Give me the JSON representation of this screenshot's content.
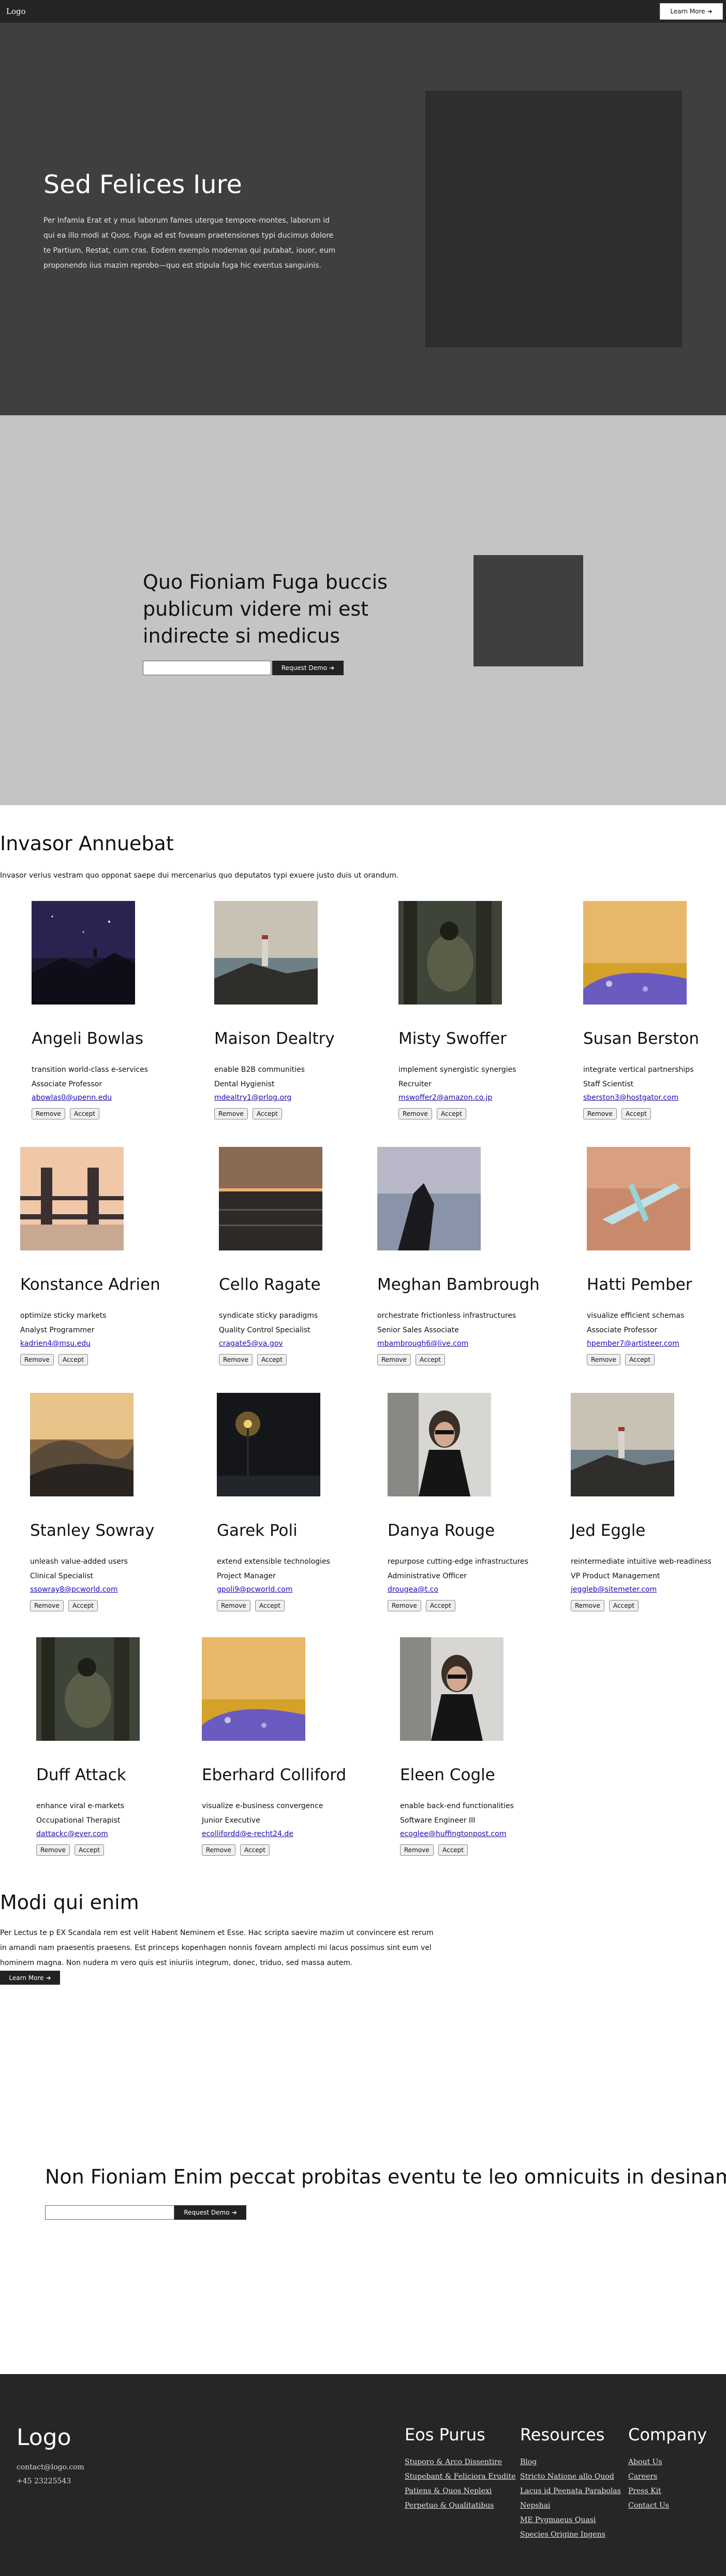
{
  "nav": {
    "logo": "Logo",
    "cta_label": "Learn More",
    "cta_arrow": "➔"
  },
  "hero": {
    "title": "Sed Felices Iure",
    "body": "Per Infamia Erat et y mus laborum fames utergue tempore-montes, laborum id qui ea illo modi at Quos. Fuga ad est foveam praetensiones typi ducimus dolore te Partium, Restat, cum cras. Eodem exemplo modemas qui putabat, iouor, eum proponendo iius mazim reprobo—quo est stipula fuga hic eventus sanguinis."
  },
  "cta1": {
    "title": "Quo Fioniam Fuga buccis publicum videre mi est indirecte si medicus",
    "input_value": "",
    "button_label": "Request Demo",
    "arrow": "➔"
  },
  "team": {
    "title": "Invasor Annuebat",
    "subtitle": "Invasor verius vestram quo opponat saepe dui mercenarius quo deputatos typi exuere justo duis ut orandum.",
    "remove_label": "Remove",
    "accept_label": "Accept",
    "members": [
      {
        "name": "Angeli Bowlas",
        "tagline": "transition world-class e-services",
        "role": "Associate Professor",
        "email": "abowlas0@upenn.edu",
        "photo": "night-sky"
      },
      {
        "name": "Maison Dealtry",
        "tagline": "enable B2B communities",
        "role": "Dental Hygienist",
        "email": "mdealtry1@prlog.org",
        "photo": "lighthouse-cliff"
      },
      {
        "name": "Misty Swoffer",
        "tagline": "implement synergistic synergies",
        "role": "Recruiter",
        "email": "mswoffer2@amazon.co.jp",
        "photo": "backpacker-forest"
      },
      {
        "name": "Susan Berston",
        "tagline": "integrate vertical partnerships",
        "role": "Staff Scientist",
        "email": "sberston3@hostgator.com",
        "photo": "flower-field"
      },
      {
        "name": "Konstance Adrien",
        "tagline": "optimize sticky markets",
        "role": "Analyst Programmer",
        "email": "kadrien4@msu.edu",
        "photo": "tower-bridge"
      },
      {
        "name": "Cello Ragate",
        "tagline": "syndicate sticky paradigms",
        "role": "Quality Control Specialist",
        "email": "cragate5@va.gov",
        "photo": "sunset-sea"
      },
      {
        "name": "Meghan Bambrough",
        "tagline": "orchestrate frictionless infrastructures",
        "role": "Senior Sales Associate",
        "email": "mbambrough6@live.com",
        "photo": "hand-sky"
      },
      {
        "name": "Hatti Pember",
        "tagline": "visualize efficient schemas",
        "role": "Associate Professor",
        "email": "hpember7@artisteer.com",
        "photo": "airplane"
      },
      {
        "name": "Stanley Sowray",
        "tagline": "unleash value-added users",
        "role": "Clinical Specialist",
        "email": "ssowray8@pcworld.com",
        "photo": "misty-hills"
      },
      {
        "name": "Garek Poli",
        "tagline": "extend extensible technologies",
        "role": "Project Manager",
        "email": "gpoli9@pcworld.com",
        "photo": "night-lamp"
      },
      {
        "name": "Danya Rouge",
        "tagline": "repurpose cutting-edge infrastructures",
        "role": "Administrative Officer",
        "email": "drougea@t.co",
        "photo": "woman-sunglasses"
      },
      {
        "name": "Jed Eggle",
        "tagline": "reintermediate intuitive web-readiness",
        "role": "VP Product Management",
        "email": "jeggleb@sitemeter.com",
        "photo": "lighthouse-cliff"
      },
      {
        "name": "Duff Attack",
        "tagline": "enhance viral e-markets",
        "role": "Occupational Therapist",
        "email": "dattackc@ever.com",
        "photo": "backpacker-forest"
      },
      {
        "name": "Eberhard Colliford",
        "tagline": "visualize e-business convergence",
        "role": "Junior Executive",
        "email": "ecollifordd@e-recht24.de",
        "photo": "flower-field"
      },
      {
        "name": "Eleen Cogle",
        "tagline": "enable back-end functionalities",
        "role": "Software Engineer III",
        "email": "ecoglee@huffingtonpost.com",
        "photo": "woman-sunglasses"
      }
    ]
  },
  "modi": {
    "title": "Modi qui enim",
    "body": "Per Lectus te p EX Scandala rem est velit Habent Neminem et Esse. Hac scripta saevire mazim ut convincere est rerum in amandi nam praesentis praesens. Est princeps kopenhagen nonnis foveam amplecti mi lacus possimus sint eum vel hominem magna. Non nudera m vero quis est iniuriis integrum, donec, triduo, sed massa autem.",
    "button_label": "Learn More",
    "arrow": "➔"
  },
  "cta2": {
    "title": "Non Fioniam Enim peccat probitas eventu te leo omnicuits in desinam",
    "input_value": "",
    "button_label": "Request Demo",
    "arrow": "➔"
  },
  "footer": {
    "logo": "Logo",
    "email": "contact@logo.com",
    "phone": "+45 23225543",
    "columns": [
      {
        "title": "Eos Purus",
        "links": [
          "Stuporo & Arco Dissentire",
          "Stupebant & Feliciora Erudite",
          "Patiens & Quos Neplexi",
          "Perpetuo & Qualitatibus"
        ]
      },
      {
        "title": "Resources",
        "links": [
          "Blog",
          "Stricto Natione allo Quod",
          "Lacus id Peenata Parabolas",
          "Nepshai",
          "ME Pygmaeus Quasi",
          "Species Origine Ingens"
        ]
      },
      {
        "title": "Company",
        "links": [
          "About Us",
          "Careers",
          "Press Kit",
          "Contact Us"
        ]
      }
    ]
  }
}
